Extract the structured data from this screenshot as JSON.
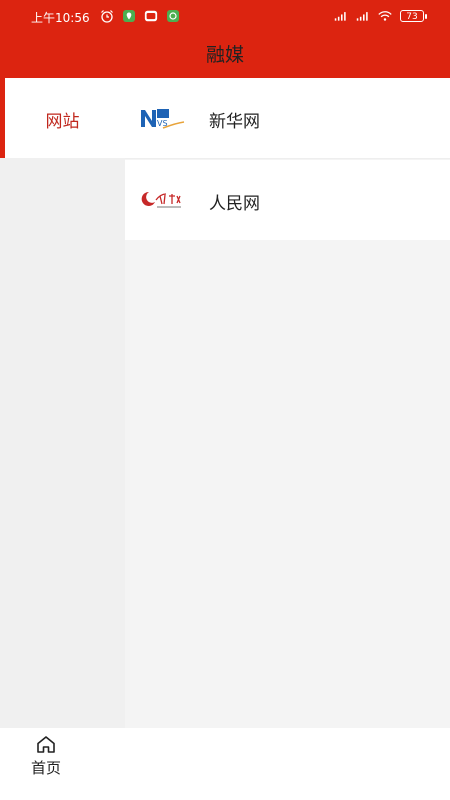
{
  "status_bar": {
    "time": "上午10:56",
    "battery": "73"
  },
  "header": {
    "title": "融媒"
  },
  "sidebar": {
    "items": [
      {
        "label": "网站",
        "selected": true
      }
    ]
  },
  "content": {
    "rows": [
      {
        "name": "新华网",
        "logo": "xinhua-logo"
      },
      {
        "name": "人民网",
        "logo": "people-logo"
      }
    ]
  },
  "tabbar": {
    "tabs": [
      {
        "label": "首页",
        "icon": "home-icon"
      }
    ]
  },
  "colors": {
    "brand": "#dc2410",
    "accent_text": "#c0281e"
  }
}
